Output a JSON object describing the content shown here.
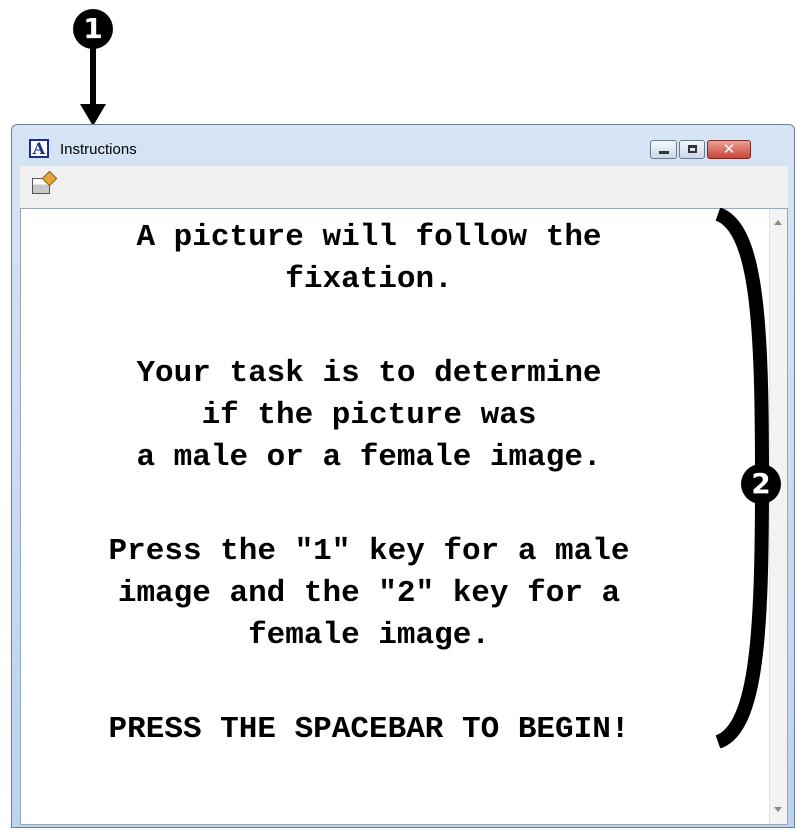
{
  "callouts": [
    "1",
    "2"
  ],
  "window": {
    "title": "Instructions",
    "app_icon_letter": "A",
    "buttons": {
      "minimize": "minimize",
      "maximize": "maximize",
      "close": "✕"
    }
  },
  "toolbar": {
    "icons": [
      "properties-icon"
    ]
  },
  "instructions": [
    "A picture will follow the\nfixation.",
    "Your task is to determine\nif the picture was\na male or a female image.",
    "Press the \"1\" key for a male\nimage and the \"2\" key for a\nfemale image.",
    "PRESS THE SPACEBAR TO BEGIN!"
  ],
  "colors": {
    "title_bar": "#c7dbf1",
    "close_button": "#c8453a",
    "text": "#000000"
  }
}
